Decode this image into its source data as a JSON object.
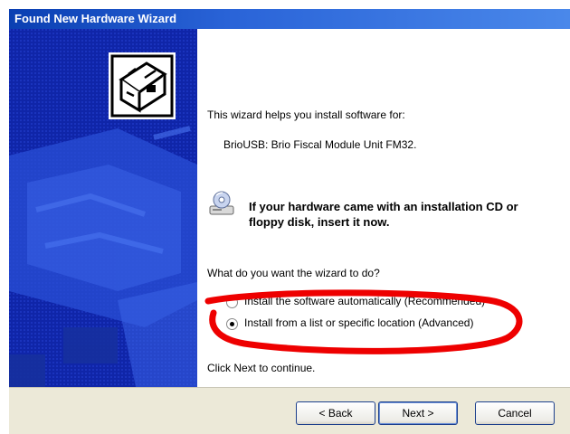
{
  "window": {
    "title": "Found New Hardware Wizard"
  },
  "content": {
    "intro": "This wizard helps you install software for:",
    "device_name": "BrioUSB: Brio Fiscal Module Unit FM32.",
    "cd_prompt": "If your hardware came with an installation CD or floppy disk, insert it now.",
    "question": "What do you want the wizard to do?",
    "options": [
      {
        "label": "Install the software automatically (Recommended)",
        "selected": false
      },
      {
        "label": "Install from a list or specific location (Advanced)",
        "selected": true
      }
    ],
    "footer_hint": "Click Next to continue."
  },
  "buttons": {
    "back": "< Back",
    "next": "Next >",
    "cancel": "Cancel"
  },
  "icons": {
    "wizard": "hardware-wizard-icon",
    "cd": "cd-drive-icon"
  },
  "colors": {
    "title_bar": "#0a3fb2",
    "side_panel": "#0f25a8",
    "annotation": "#ee0000",
    "button_face": "#ece9d8"
  }
}
